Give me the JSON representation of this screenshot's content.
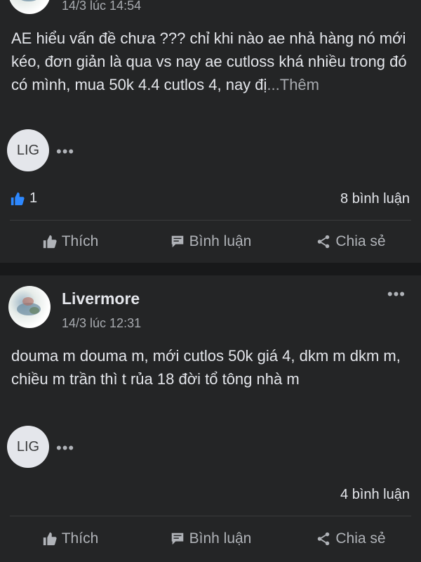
{
  "posts": [
    {
      "timestamp": "14/3 lúc 14:54",
      "text": "AE hiểu vấn đề chưa ??? chỉ khi nào ae nhả hàng nó mới kéo, đơn giản là qua vs nay ae cutloss khá nhiều trong đó có mình, mua 50k 4.4 cutlos 4, nay đị",
      "see_more": "...Thêm",
      "commenter_initials": "LIG",
      "more_dots": "•••",
      "like_count": "1",
      "comment_count": "8 bình luận",
      "actions": {
        "like": "Thích",
        "comment": "Bình luận",
        "share": "Chia sẻ"
      }
    },
    {
      "author": "Livermore",
      "timestamp": "14/3 lúc 12:31",
      "menu_dots": "•••",
      "text": "douma m douma m, mới cutlos 50k giá 4, dkm m dkm m, chiều m trần thì t rủa 18 đời tổ tông nhà m",
      "commenter_initials": "LIG",
      "more_dots": "•••",
      "comment_count": "4 bình luận",
      "actions": {
        "like": "Thích",
        "comment": "Bình luận",
        "share": "Chia sẻ"
      }
    }
  ],
  "colors": {
    "background": "#18191a",
    "card": "#242526",
    "text": "#e4e6eb",
    "muted": "#a8abb0",
    "like_blue": "#2d88ff"
  }
}
